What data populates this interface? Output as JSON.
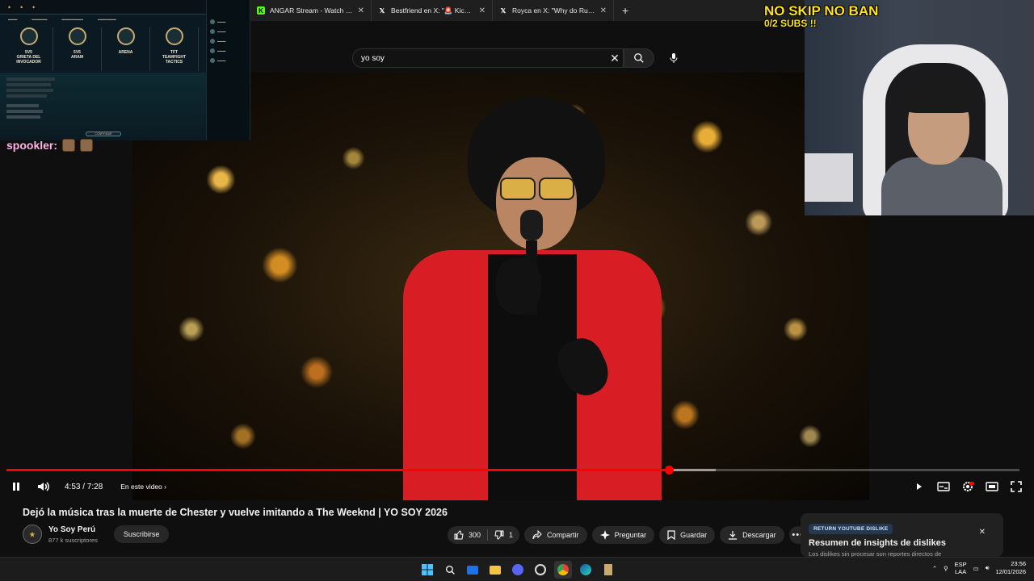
{
  "browser": {
    "tabs": [
      {
        "label": "ANGAR Stream - Watch Live on",
        "favicon": "kick-icon",
        "color": "#53fc18"
      },
      {
        "label": "Bestfriend en X: \"🚨 Kick Strea",
        "favicon": "x-icon",
        "color": "#ffffff"
      },
      {
        "label": "Royca en X: \"Why do Russians",
        "favicon": "x-icon",
        "color": "#ffffff"
      }
    ],
    "new_tab": "+"
  },
  "search": {
    "value": "yo soy",
    "placeholder": "Buscar"
  },
  "player": {
    "current_time": "4:53",
    "duration": "7:28",
    "time_display": "4:53 / 7:28",
    "chapter_label": "En este video",
    "played_fraction": 0.654,
    "buffered_fraction": 0.7,
    "accent": "#ff0000"
  },
  "video_info": {
    "title": "Dejó la música tras la muerte de Chester y vuelve imitando a The Weeknd | YO SOY 2026",
    "channel_name": "Yo Soy Perú",
    "subscribers": "877 k suscriptores",
    "subscribe_label": "Suscribirse",
    "likes": "300",
    "dislikes": "1",
    "share_label": "Compartir",
    "ask_label": "Preguntar",
    "save_label": "Guardar",
    "download_label": "Descargar"
  },
  "ryd_popup": {
    "badge": "RETURN YOUTUBE DISLIKE",
    "title": "Resumen de insights de dislikes",
    "description": "Los dislikes sin procesar son reportes directos de"
  },
  "stream_overlay": {
    "banner_line1": "NO SKIP NO BAN",
    "banner_line2": "0/2 SUBS !!",
    "chat_user": "spookler:",
    "banner_color": "#ffe21a"
  },
  "game_client": {
    "modes": [
      {
        "label": "5V5\nGRIETA DEL\nINVOCADOR"
      },
      {
        "label": "5V5\nARAM"
      },
      {
        "label": "ARENA"
      },
      {
        "label": "TFT\nTEAMFIGHT\nTACTICS"
      }
    ],
    "confirm_label": "CONFIRMAR"
  },
  "taskbar": {
    "lang_line1": "ESP",
    "lang_line2": "LAA",
    "time": "23:56",
    "date": "12/01/2026"
  }
}
